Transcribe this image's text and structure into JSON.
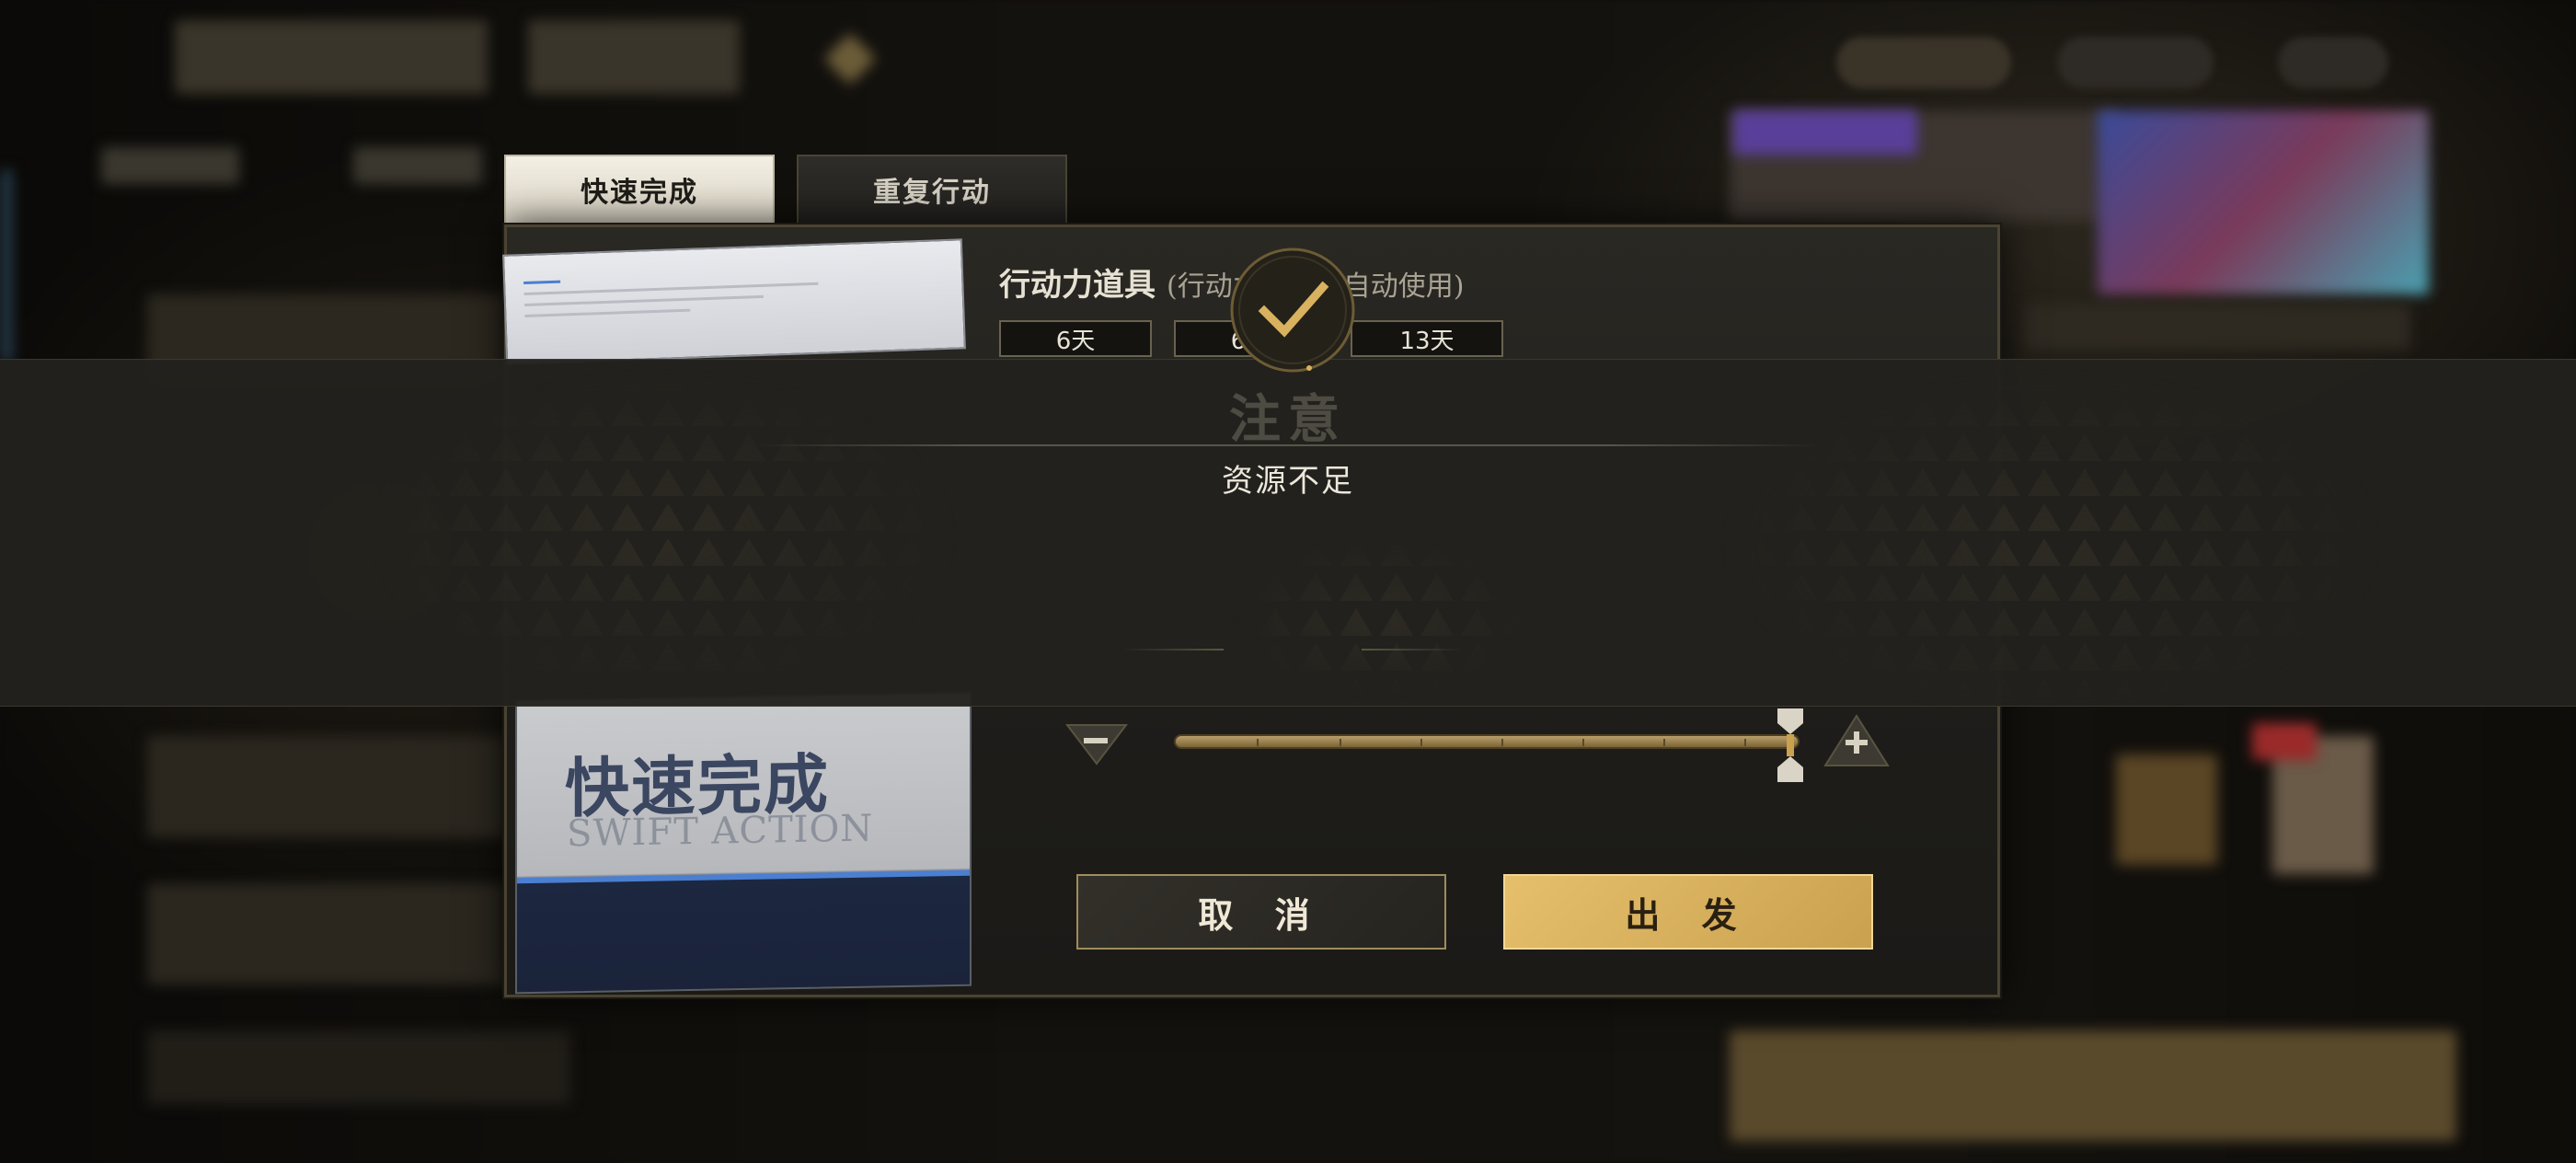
{
  "tabs": {
    "active": "快速完成",
    "inactive": "重复行动"
  },
  "resource": {
    "title": "行动力道具",
    "note": "(行动力不够时自动使用)",
    "chips": [
      "6天",
      "6天",
      "13天"
    ]
  },
  "card": {
    "title": "快速完成",
    "subtitle": "SWIFT ACTION"
  },
  "buttons": {
    "cancel": "取 消",
    "go": "出 发"
  },
  "notice": {
    "title": "注意",
    "message": "资源不足"
  },
  "colors": {
    "accent_gold": "#d9b25f",
    "panel_dark": "#1e1d1a",
    "notice_bg": "#22211d"
  },
  "icons": {
    "confirm": "checkmark-icon",
    "decrease": "minus-icon",
    "increase": "plus-icon"
  }
}
